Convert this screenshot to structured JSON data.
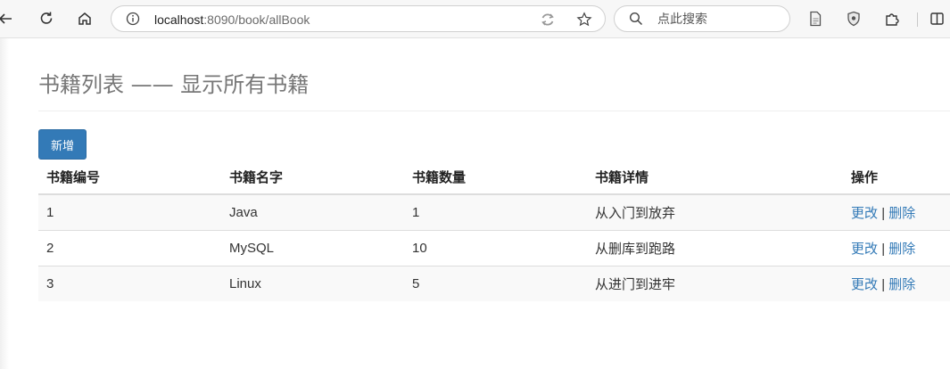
{
  "browser": {
    "url_host": "localhost",
    "url_rest": ":8090/book/allBook",
    "search_placeholder": "点此搜索"
  },
  "page": {
    "title": "书籍列表 —— 显示所有书籍",
    "add_button": "新增"
  },
  "table": {
    "headers": [
      "书籍编号",
      "书籍名字",
      "书籍数量",
      "书籍详情",
      "操作"
    ],
    "rows": [
      {
        "id": "1",
        "name": "Java",
        "count": "1",
        "detail": "从入门到放弃"
      },
      {
        "id": "2",
        "name": "MySQL",
        "count": "10",
        "detail": "从删库到跑路"
      },
      {
        "id": "3",
        "name": "Linux",
        "count": "5",
        "detail": "从进门到进牢"
      }
    ],
    "edit_label": "更改",
    "separator": "|",
    "delete_label": "删除"
  },
  "colors": {
    "primary": "#337ab7",
    "title_gray": "#777777"
  }
}
